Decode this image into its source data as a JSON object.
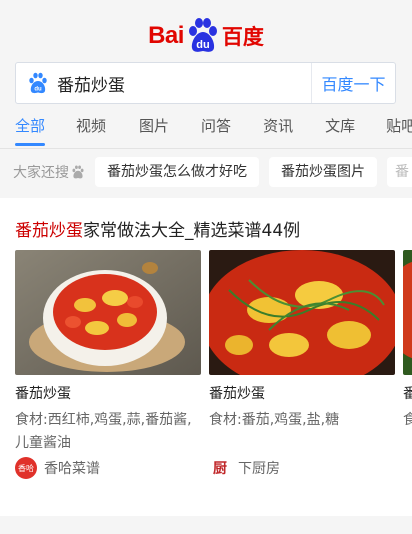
{
  "logo": {
    "bai": "Bai",
    "du": "du",
    "zh": "百度"
  },
  "search": {
    "query": "番茄炒蛋",
    "button": "百度一下"
  },
  "tabs": [
    "全部",
    "视频",
    "图片",
    "问答",
    "资讯",
    "文库",
    "贴吧"
  ],
  "also_searched": {
    "label": "大家还搜",
    "chips": [
      "番茄炒蛋怎么做才好吃",
      "番茄炒蛋图片",
      "番"
    ]
  },
  "card": {
    "title_highlight": "番茄炒蛋",
    "title_rest": "家常做法大全_精选菜谱44例",
    "recipes": [
      {
        "name": "番茄炒蛋",
        "ingredients": "食材:西红柿,鸡蛋,蒜,番茄酱,儿童酱油",
        "source": "香哈菜谱",
        "badge": "香哈"
      },
      {
        "name": "番茄炒蛋",
        "ingredients": "食材:番茄,鸡蛋,盐,糖",
        "source": "下厨房",
        "badge": "厨"
      },
      {
        "name": "番",
        "ingredients": "食材",
        "source": "",
        "badge": ""
      }
    ]
  },
  "colors": {
    "accent": "#3388ff",
    "brand_red": "#e10601",
    "highlight": "#cc0000"
  }
}
